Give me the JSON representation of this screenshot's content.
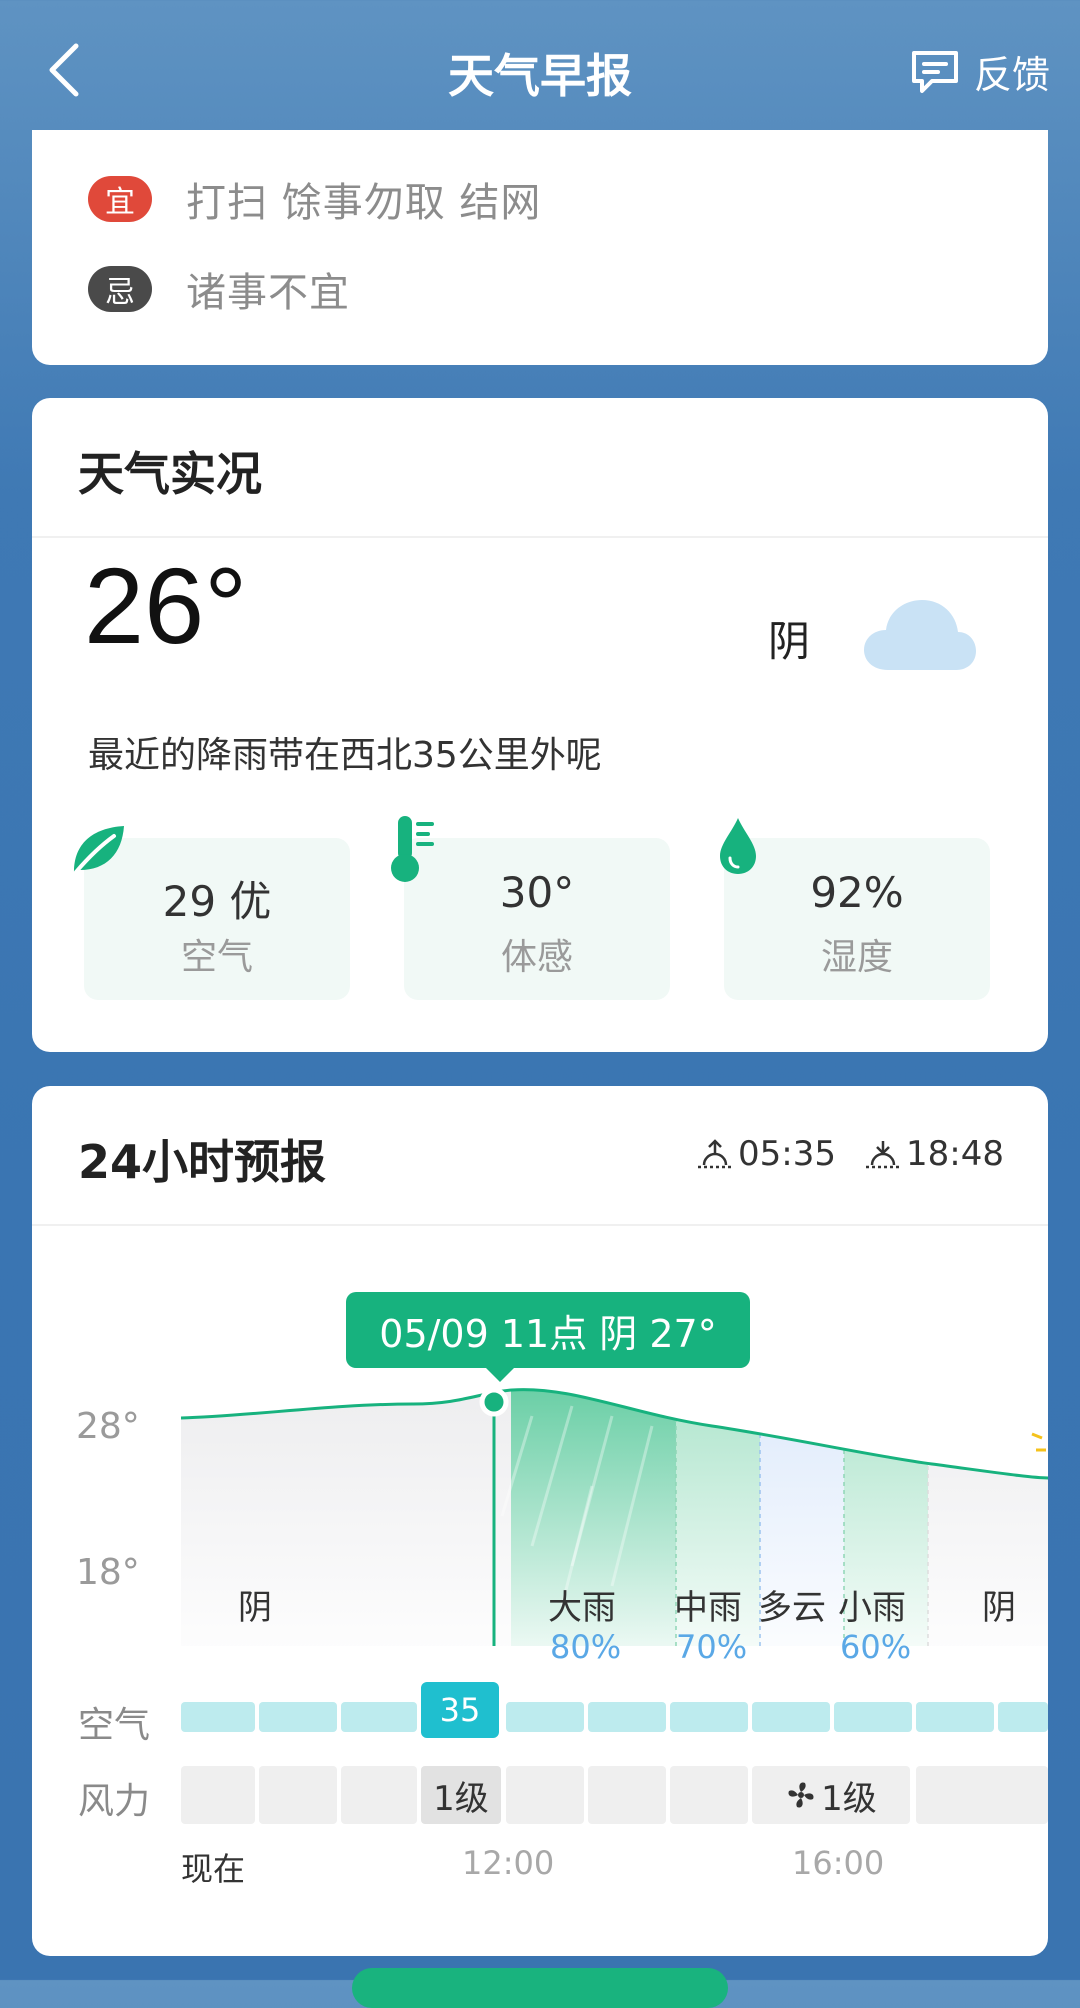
{
  "header": {
    "title": "天气早报",
    "feedback_label": "反馈"
  },
  "almanac": {
    "yi_badge": "宜",
    "yi_text": "打扫 馀事勿取 结网",
    "ji_badge": "忌",
    "ji_text": "诸事不宜"
  },
  "current": {
    "section_title": "天气实况",
    "temperature": "26°",
    "condition": "阴",
    "rain_note": "最近的降雨带在西北35公里外呢",
    "stats": [
      {
        "value": "29 优",
        "label": "空气",
        "icon": "leaf-icon"
      },
      {
        "value": "30°",
        "label": "体感",
        "icon": "thermometer-icon"
      },
      {
        "value": "92%",
        "label": "湿度",
        "icon": "droplet-icon"
      }
    ]
  },
  "forecast": {
    "section_title": "24小时预报",
    "sunrise": "05:35",
    "sunset": "18:48",
    "tooltip": "05/09 11点 阴 27°",
    "y_ticks": [
      "28°",
      "18°"
    ],
    "weather_labels": [
      "阴",
      "大雨",
      "中雨",
      "多云",
      "小雨",
      "阴"
    ],
    "precip_labels": [
      "80%",
      "70%",
      "60%"
    ],
    "air_row_label": "空气",
    "air_active_value": "35",
    "wind_row_label": "风力",
    "wind_labels": [
      "1级",
      "1级"
    ],
    "time_labels": [
      "现在",
      "12:00",
      "16:00"
    ]
  },
  "colors": {
    "accent_green": "#17b27e",
    "yi_red": "#e0493a",
    "precip_blue": "#5aa8e6",
    "air_cyan": "#1fbfcf"
  }
}
